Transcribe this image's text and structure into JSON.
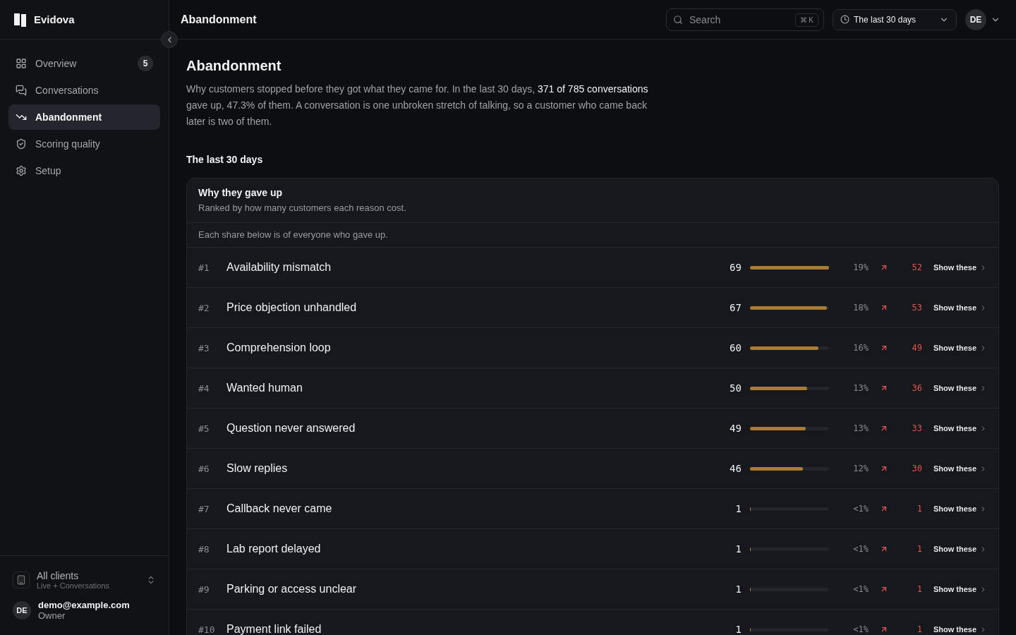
{
  "brand": {
    "name": "Evidova"
  },
  "nav": [
    {
      "label": "Overview",
      "selected": false,
      "badge": "5"
    },
    {
      "label": "Conversations",
      "selected": false
    },
    {
      "label": "Abandonment",
      "selected": true
    },
    {
      "label": "Scoring quality",
      "selected": false
    },
    {
      "label": "Setup",
      "selected": false
    }
  ],
  "workspace": {
    "name": "All clients",
    "subtitle": "Live + Conversations"
  },
  "account": {
    "initials": "DE",
    "email": "demo@example.com",
    "role": "Owner"
  },
  "topbar": {
    "title": "Abandonment",
    "search_placeholder": "Search",
    "shortcut": "⌘ K",
    "range": "The last 30 days",
    "avatar": "DE"
  },
  "page": {
    "title": "Abandonment",
    "intro": "Why customers stopped before they got what they came for. In the last 30 days, **371 of 785 conversations** gave up, 47.3% of them. A conversation is one unbroken stretch of talking, so a customer who came back later is two of them.",
    "section": "The last 30 days"
  },
  "card": {
    "title": "Why they gave up",
    "subtitle": "Ranked by how many customers each reason cost.",
    "note": "Each share below is of everyone who gave up.",
    "rows": [
      {
        "rank": "#1",
        "reason": "Availability mismatch",
        "count": "69",
        "level": 1.0,
        "share": "19%",
        "delta": "52",
        "action": "Show these"
      },
      {
        "rank": "#2",
        "reason": "Price objection unhandled",
        "count": "67",
        "level": 0.97,
        "share": "18%",
        "delta": "53",
        "action": "Show these"
      },
      {
        "rank": "#3",
        "reason": "Comprehension loop",
        "count": "60",
        "level": 0.87,
        "share": "16%",
        "delta": "49",
        "action": "Show these"
      },
      {
        "rank": "#4",
        "reason": "Wanted human",
        "count": "50",
        "level": 0.72,
        "share": "13%",
        "delta": "36",
        "action": "Show these"
      },
      {
        "rank": "#5",
        "reason": "Question never answered",
        "count": "49",
        "level": 0.71,
        "share": "13%",
        "delta": "33",
        "action": "Show these"
      },
      {
        "rank": "#6",
        "reason": "Slow replies",
        "count": "46",
        "level": 0.67,
        "share": "12%",
        "delta": "30",
        "action": "Show these"
      },
      {
        "rank": "#7",
        "reason": "Callback never came",
        "count": "1",
        "level": 0.01,
        "share": "<1%",
        "delta": "1",
        "action": "Show these"
      },
      {
        "rank": "#8",
        "reason": "Lab report delayed",
        "count": "1",
        "level": 0.01,
        "share": "<1%",
        "delta": "1",
        "action": "Show these"
      },
      {
        "rank": "#9",
        "reason": "Parking or access unclear",
        "count": "1",
        "level": 0.01,
        "share": "<1%",
        "delta": "1",
        "action": "Show these"
      },
      {
        "rank": "#10",
        "reason": "Payment link failed",
        "count": "1",
        "level": 0.01,
        "share": "<1%",
        "delta": "1",
        "action": "Show these"
      }
    ]
  }
}
